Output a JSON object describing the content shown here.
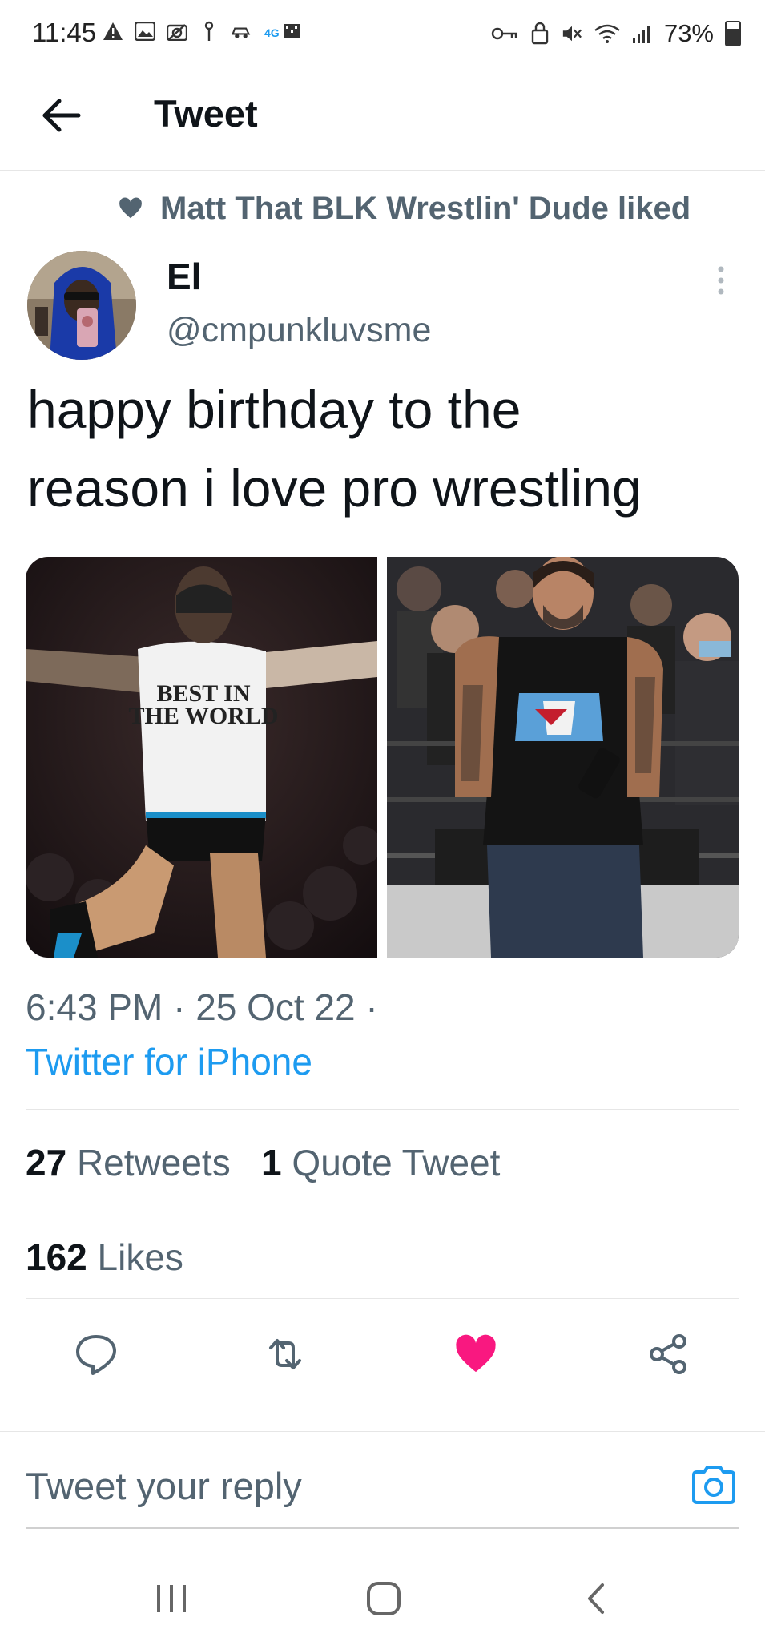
{
  "status_bar": {
    "time": "11:45",
    "battery": "73%",
    "battery_level": 0.73,
    "left_icons": [
      "alert-icon",
      "image-icon",
      "camera-off-icon",
      "nfc-icon",
      "car-icon",
      "4g-icon"
    ],
    "right_icons": [
      "key-icon",
      "lock-icon",
      "mute-icon",
      "wifi-icon",
      "signal-icon",
      "battery-icon"
    ]
  },
  "header": {
    "title": "Tweet",
    "back_icon": "arrow-left-icon"
  },
  "social_context": {
    "text": "Matt That BLK Wrestlin' Dude liked",
    "icon": "heart-icon"
  },
  "author": {
    "name": "El",
    "handle": "@cmpunkluvsme"
  },
  "tweet": {
    "text_line1": "happy birthday to the",
    "text_line2": "reason i love pro wrestling",
    "media": [
      {
        "shirt_line1": "BEST IN",
        "shirt_line2": "THE WORLD"
      },
      {}
    ],
    "timestamp": "6:43 PM · 25 Oct 22 ·",
    "client": "Twitter for iPhone"
  },
  "stats": {
    "retweets_count": "27",
    "retweets_label": "Retweets",
    "quotes_count": "1",
    "quotes_label": "Quote Tweet",
    "likes_count": "162",
    "likes_label": "Likes"
  },
  "actions": [
    {
      "name": "reply",
      "icon": "reply-icon"
    },
    {
      "name": "retweet",
      "icon": "retweet-icon"
    },
    {
      "name": "like",
      "icon": "heart-icon",
      "active": true,
      "color": "#f91880"
    },
    {
      "name": "share",
      "icon": "share-icon"
    }
  ],
  "reply": {
    "placeholder": "Tweet your reply",
    "icon": "camera-icon"
  },
  "nav": [
    "recents-icon",
    "home-icon",
    "back-icon"
  ],
  "colors": {
    "accent": "#1d9bf0",
    "like": "#f91880",
    "secondary_text": "#536471"
  }
}
